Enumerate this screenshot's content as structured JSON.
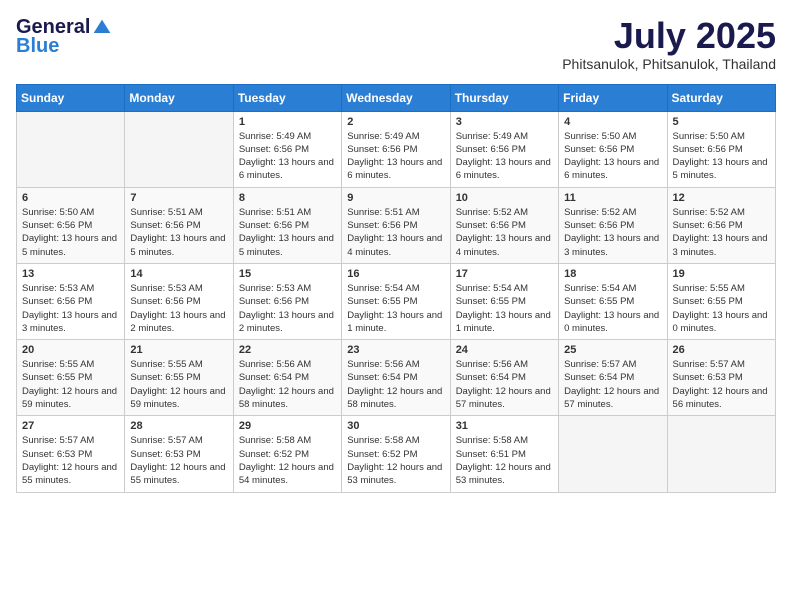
{
  "header": {
    "logo_general": "General",
    "logo_blue": "Blue",
    "month_title": "July 2025",
    "location": "Phitsanulok, Phitsanulok, Thailand"
  },
  "days_of_week": [
    "Sunday",
    "Monday",
    "Tuesday",
    "Wednesday",
    "Thursday",
    "Friday",
    "Saturday"
  ],
  "weeks": [
    [
      {
        "day": "",
        "info": ""
      },
      {
        "day": "",
        "info": ""
      },
      {
        "day": "1",
        "info": "Sunrise: 5:49 AM\nSunset: 6:56 PM\nDaylight: 13 hours and 6 minutes."
      },
      {
        "day": "2",
        "info": "Sunrise: 5:49 AM\nSunset: 6:56 PM\nDaylight: 13 hours and 6 minutes."
      },
      {
        "day": "3",
        "info": "Sunrise: 5:49 AM\nSunset: 6:56 PM\nDaylight: 13 hours and 6 minutes."
      },
      {
        "day": "4",
        "info": "Sunrise: 5:50 AM\nSunset: 6:56 PM\nDaylight: 13 hours and 6 minutes."
      },
      {
        "day": "5",
        "info": "Sunrise: 5:50 AM\nSunset: 6:56 PM\nDaylight: 13 hours and 5 minutes."
      }
    ],
    [
      {
        "day": "6",
        "info": "Sunrise: 5:50 AM\nSunset: 6:56 PM\nDaylight: 13 hours and 5 minutes."
      },
      {
        "day": "7",
        "info": "Sunrise: 5:51 AM\nSunset: 6:56 PM\nDaylight: 13 hours and 5 minutes."
      },
      {
        "day": "8",
        "info": "Sunrise: 5:51 AM\nSunset: 6:56 PM\nDaylight: 13 hours and 5 minutes."
      },
      {
        "day": "9",
        "info": "Sunrise: 5:51 AM\nSunset: 6:56 PM\nDaylight: 13 hours and 4 minutes."
      },
      {
        "day": "10",
        "info": "Sunrise: 5:52 AM\nSunset: 6:56 PM\nDaylight: 13 hours and 4 minutes."
      },
      {
        "day": "11",
        "info": "Sunrise: 5:52 AM\nSunset: 6:56 PM\nDaylight: 13 hours and 3 minutes."
      },
      {
        "day": "12",
        "info": "Sunrise: 5:52 AM\nSunset: 6:56 PM\nDaylight: 13 hours and 3 minutes."
      }
    ],
    [
      {
        "day": "13",
        "info": "Sunrise: 5:53 AM\nSunset: 6:56 PM\nDaylight: 13 hours and 3 minutes."
      },
      {
        "day": "14",
        "info": "Sunrise: 5:53 AM\nSunset: 6:56 PM\nDaylight: 13 hours and 2 minutes."
      },
      {
        "day": "15",
        "info": "Sunrise: 5:53 AM\nSunset: 6:56 PM\nDaylight: 13 hours and 2 minutes."
      },
      {
        "day": "16",
        "info": "Sunrise: 5:54 AM\nSunset: 6:55 PM\nDaylight: 13 hours and 1 minute."
      },
      {
        "day": "17",
        "info": "Sunrise: 5:54 AM\nSunset: 6:55 PM\nDaylight: 13 hours and 1 minute."
      },
      {
        "day": "18",
        "info": "Sunrise: 5:54 AM\nSunset: 6:55 PM\nDaylight: 13 hours and 0 minutes."
      },
      {
        "day": "19",
        "info": "Sunrise: 5:55 AM\nSunset: 6:55 PM\nDaylight: 13 hours and 0 minutes."
      }
    ],
    [
      {
        "day": "20",
        "info": "Sunrise: 5:55 AM\nSunset: 6:55 PM\nDaylight: 12 hours and 59 minutes."
      },
      {
        "day": "21",
        "info": "Sunrise: 5:55 AM\nSunset: 6:55 PM\nDaylight: 12 hours and 59 minutes."
      },
      {
        "day": "22",
        "info": "Sunrise: 5:56 AM\nSunset: 6:54 PM\nDaylight: 12 hours and 58 minutes."
      },
      {
        "day": "23",
        "info": "Sunrise: 5:56 AM\nSunset: 6:54 PM\nDaylight: 12 hours and 58 minutes."
      },
      {
        "day": "24",
        "info": "Sunrise: 5:56 AM\nSunset: 6:54 PM\nDaylight: 12 hours and 57 minutes."
      },
      {
        "day": "25",
        "info": "Sunrise: 5:57 AM\nSunset: 6:54 PM\nDaylight: 12 hours and 57 minutes."
      },
      {
        "day": "26",
        "info": "Sunrise: 5:57 AM\nSunset: 6:53 PM\nDaylight: 12 hours and 56 minutes."
      }
    ],
    [
      {
        "day": "27",
        "info": "Sunrise: 5:57 AM\nSunset: 6:53 PM\nDaylight: 12 hours and 55 minutes."
      },
      {
        "day": "28",
        "info": "Sunrise: 5:57 AM\nSunset: 6:53 PM\nDaylight: 12 hours and 55 minutes."
      },
      {
        "day": "29",
        "info": "Sunrise: 5:58 AM\nSunset: 6:52 PM\nDaylight: 12 hours and 54 minutes."
      },
      {
        "day": "30",
        "info": "Sunrise: 5:58 AM\nSunset: 6:52 PM\nDaylight: 12 hours and 53 minutes."
      },
      {
        "day": "31",
        "info": "Sunrise: 5:58 AM\nSunset: 6:51 PM\nDaylight: 12 hours and 53 minutes."
      },
      {
        "day": "",
        "info": ""
      },
      {
        "day": "",
        "info": ""
      }
    ]
  ]
}
